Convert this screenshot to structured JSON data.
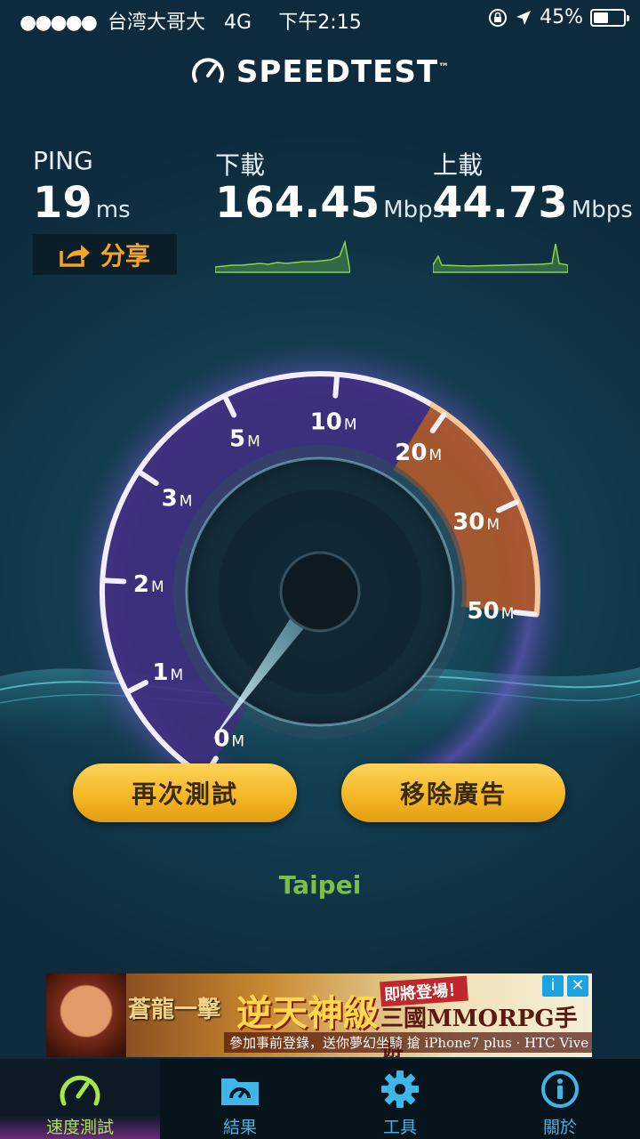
{
  "status_bar": {
    "signal_dots": "●●●●●",
    "carrier": "台湾大哥大",
    "network": "4G",
    "time": "下午2:15",
    "battery": "45%"
  },
  "header": {
    "title": "SPEEDTEST",
    "trademark": "™"
  },
  "stats": {
    "ping": {
      "label": "PING",
      "value": "19",
      "unit": "ms"
    },
    "download": {
      "label": "下載",
      "value": "164.45",
      "unit": "Mbps"
    },
    "upload": {
      "label": "上載",
      "value": "44.73",
      "unit": "Mbps"
    },
    "share_label": "分享"
  },
  "gauge": {
    "tick_labels": [
      {
        "num": "0",
        "unit": "M"
      },
      {
        "num": "1",
        "unit": "M"
      },
      {
        "num": "2",
        "unit": "M"
      },
      {
        "num": "3",
        "unit": "M"
      },
      {
        "num": "5",
        "unit": "M"
      },
      {
        "num": "10",
        "unit": "M"
      },
      {
        "num": "20",
        "unit": "M"
      },
      {
        "num": "30",
        "unit": "M"
      },
      {
        "num": "50",
        "unit": "M"
      }
    ],
    "needle_value_mbps": 0,
    "colors": {
      "purple_arc": "#4a3a8c",
      "orange_arc": "#e8873a",
      "accent_cyan": "#8fe3f0"
    }
  },
  "actions": {
    "retest_label": "再次測試",
    "remove_ads_label": "移除廣告"
  },
  "server_location": "Taipei",
  "ad": {
    "game_logo": "蒼龍一擊",
    "headline": "逆天神級",
    "tag": "即將登場！",
    "subtitle": "三國MMORPG手遊",
    "promo": "參加事前登錄，送你夢幻坐騎 搶 iPhone7 plus · HTC Vive"
  },
  "tabs": [
    {
      "label": "速度測試",
      "icon": "speedometer-icon",
      "active": true
    },
    {
      "label": "結果",
      "icon": "results-folder-icon",
      "active": false
    },
    {
      "label": "工具",
      "icon": "gear-icon",
      "active": false
    },
    {
      "label": "關於",
      "icon": "info-icon",
      "active": false
    }
  ]
}
